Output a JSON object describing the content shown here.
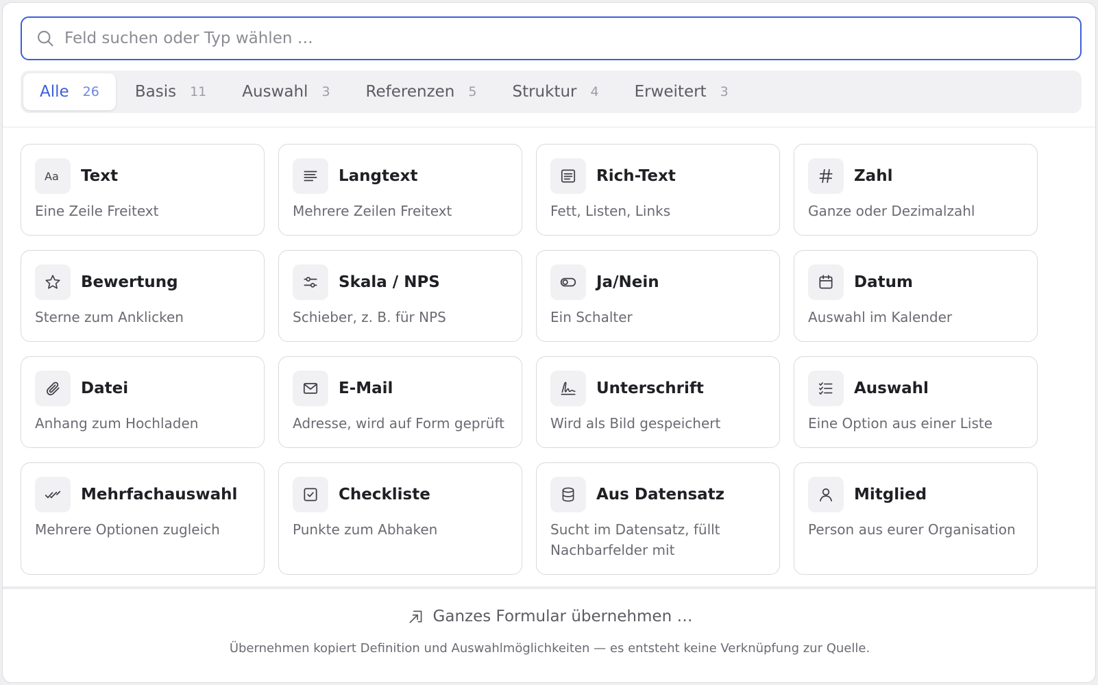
{
  "search": {
    "placeholder": "Feld suchen oder Typ wählen …",
    "icon": "search-icon"
  },
  "tabs": [
    {
      "label": "Alle",
      "count": "26",
      "active": true
    },
    {
      "label": "Basis",
      "count": "11"
    },
    {
      "label": "Auswahl",
      "count": "3"
    },
    {
      "label": "Referenzen",
      "count": "5"
    },
    {
      "label": "Struktur",
      "count": "4"
    },
    {
      "label": "Erweitert",
      "count": "3"
    }
  ],
  "fields": [
    {
      "icon": "text-aa-icon",
      "title": "Text",
      "desc": "Eine Zeile Freitext"
    },
    {
      "icon": "lines-icon",
      "title": "Langtext",
      "desc": "Mehrere Zeilen Freitext"
    },
    {
      "icon": "rich-text-icon",
      "title": "Rich-Text",
      "desc": "Fett, Listen, Links"
    },
    {
      "icon": "hash-icon",
      "title": "Zahl",
      "desc": "Ganze oder Dezimalzahl"
    },
    {
      "icon": "star-icon",
      "title": "Bewertung",
      "desc": "Sterne zum Anklicken"
    },
    {
      "icon": "sliders-icon",
      "title": "Skala / NPS",
      "desc": "Schieber, z. B. für NPS"
    },
    {
      "icon": "toggle-icon",
      "title": "Ja/Nein",
      "desc": "Ein Schalter"
    },
    {
      "icon": "calendar-icon",
      "title": "Datum",
      "desc": "Auswahl im Kalender"
    },
    {
      "icon": "paperclip-icon",
      "title": "Datei",
      "desc": "Anhang zum Hochladen"
    },
    {
      "icon": "mail-icon",
      "title": "E-Mail",
      "desc": "Adresse, wird auf Form geprüft"
    },
    {
      "icon": "signature-icon",
      "title": "Unterschrift",
      "desc": "Wird als Bild gespeichert"
    },
    {
      "icon": "list-check-icon",
      "title": "Auswahl",
      "desc": "Eine Option aus einer Liste"
    },
    {
      "icon": "double-check-icon",
      "title": "Mehrfachauswahl",
      "desc": "Mehrere Optionen zugleich"
    },
    {
      "icon": "checkbox-icon",
      "title": "Checkliste",
      "desc": "Punkte zum Abhaken"
    },
    {
      "icon": "database-icon",
      "title": "Aus Datensatz",
      "desc": "Sucht im Datensatz, füllt Nachbarfelder mit"
    },
    {
      "icon": "user-icon",
      "title": "Mitglied",
      "desc": "Person aus eurer Organisation"
    }
  ],
  "footer": {
    "action_label": "Ganzes Formular übernehmen …",
    "action_icon": "import-icon",
    "note": "Übernehmen kopiert Definition und Auswahlmöglichkeiten — es entsteht keine Verknüpfung zur Quelle."
  },
  "colors": {
    "accent": "#3b5fd9",
    "text": "#1f2024",
    "muted": "#6a6b72",
    "icon_bg": "#f1f1f3",
    "border": "#d9d9dd"
  }
}
